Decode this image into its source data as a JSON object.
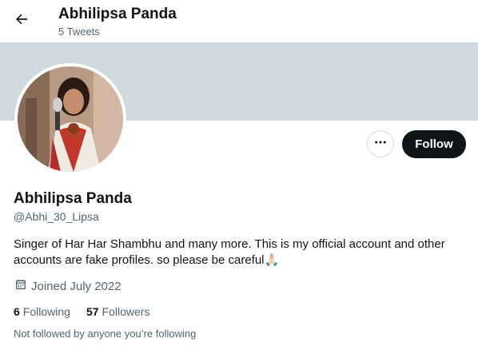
{
  "header": {
    "title": "Abhilipsa Panda",
    "subtitle": "5 Tweets",
    "back_icon": "arrow-left-icon"
  },
  "profile": {
    "name": "Abhilipsa Panda",
    "handle": "@Abhi_30_Lipsa",
    "bio": "Singer of Har Har Shambhu and many more. This is my official account and other accounts are fake profiles. so please be careful🙏🏻",
    "joined": "Joined July 2022",
    "calendar_icon": "calendar-icon"
  },
  "actions": {
    "more_icon": "more-dots-icon",
    "follow_label": "Follow"
  },
  "stats": {
    "following_count": "6",
    "following_label": "Following",
    "followers_count": "57",
    "followers_label": "Followers"
  },
  "notice": "Not followed by anyone you’re following",
  "colors": {
    "banner": "#cfd9de",
    "follow_button": "#0f1419",
    "secondary_text": "#536471"
  }
}
